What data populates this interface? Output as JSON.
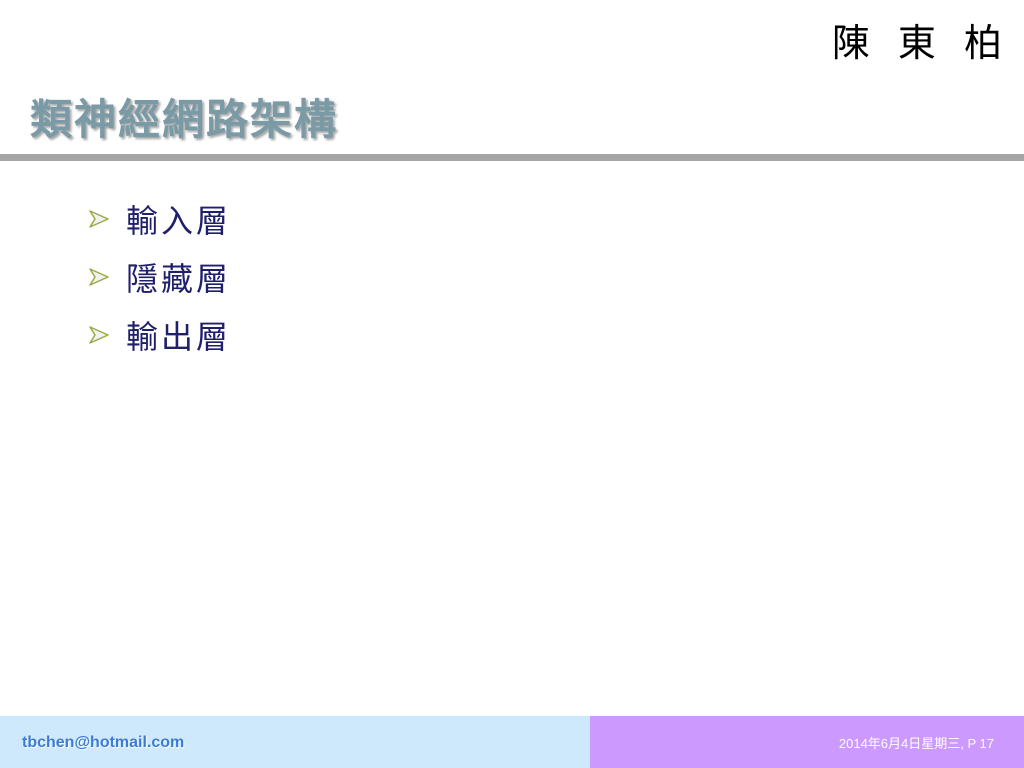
{
  "slide": {
    "author": "陳 東 柏",
    "title": "類神經網路架構",
    "bullets": [
      {
        "icon": "arrow-bullet-icon",
        "text": "輸入層"
      },
      {
        "icon": "arrow-bullet-icon",
        "text": "隱藏層"
      },
      {
        "icon": "arrow-bullet-icon",
        "text": "輸出層"
      }
    ]
  },
  "footer": {
    "email": "tbchen@hotmail.com",
    "date_page": "2014年6月4日星期三, P 17"
  },
  "colors": {
    "title": "#7a9aa6",
    "bullet_text": "#1f1f6b",
    "divider": "#a6a6a6",
    "footer_left_bg": "#cde9fb",
    "footer_right_bg": "#cc99ff",
    "email": "#3d7bd6",
    "arrow_fill": "#f2f2f2",
    "arrow_stroke": "#9aaa44"
  }
}
